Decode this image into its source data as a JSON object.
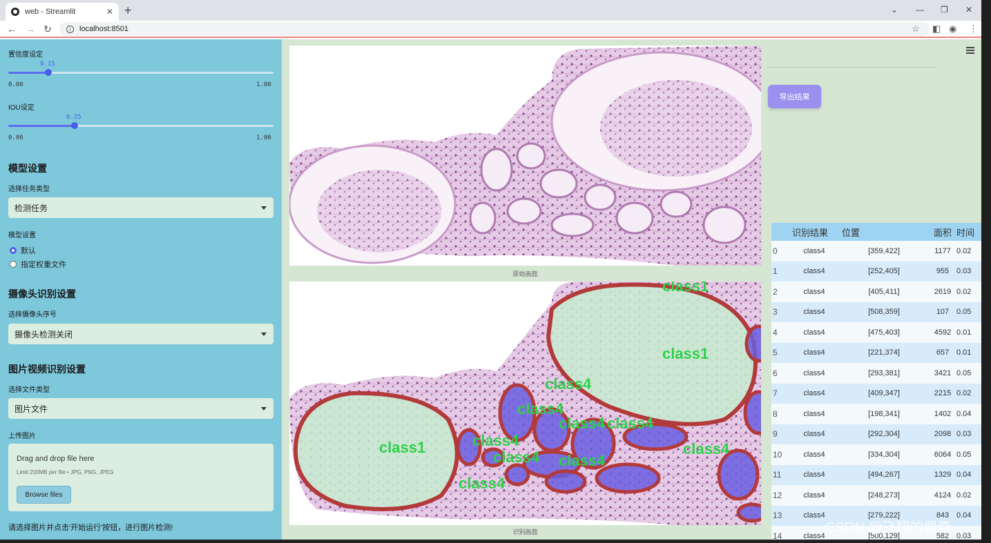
{
  "browser": {
    "tab_title": "web - Streamlit",
    "url": "localhost:8501"
  },
  "sidebar": {
    "confidence": {
      "label": "置信度设定",
      "value": "0.15",
      "value_fraction": 0.15,
      "min": "0.00",
      "max": "1.00"
    },
    "iou": {
      "label": "IOU设定",
      "value": "0.25",
      "value_fraction": 0.25,
      "min": "0.00",
      "max": "1.00"
    },
    "model_section": "模型设置",
    "task_label": "选择任务类型",
    "task_value": "检测任务",
    "model_label": "模型设置",
    "radio_default": "默认",
    "radio_custom": "指定权重文件",
    "camera_section": "摄像头识别设置",
    "camera_label": "选择摄像头序号",
    "camera_value": "摄像头检测关闭",
    "media_section": "图片视频识别设置",
    "file_type_label": "选择文件类型",
    "file_type_value": "图片文件",
    "upload_label": "上传图片",
    "upload_drag": "Drag and drop file here",
    "upload_limit": "Limit 200MB per file • JPG, PNG, JPEG",
    "browse_button": "Browse files",
    "footer_hint": "请选择图片并点击'开始运行'按钮，进行图片检测!"
  },
  "main": {
    "original_caption": "原始画面",
    "result_caption": "识别画面",
    "export_button": "导出结果",
    "overlay_labels": [
      "class1",
      "class1",
      "class1",
      "class4",
      "class4",
      "class4",
      "class4",
      "class4",
      "class4",
      "class4",
      "class4",
      "class4"
    ],
    "table": {
      "headers": [
        "",
        "识别结果",
        "位置",
        "面积",
        "时间"
      ],
      "rows": [
        [
          "0",
          "class4",
          "[359,422]",
          "1177",
          "0.02"
        ],
        [
          "1",
          "class4",
          "[252,405]",
          "955",
          "0.03"
        ],
        [
          "2",
          "class4",
          "[405,411]",
          "2619",
          "0.02"
        ],
        [
          "3",
          "class4",
          "[508,359]",
          "107",
          "0.05"
        ],
        [
          "4",
          "class4",
          "[475,403]",
          "4592",
          "0.01"
        ],
        [
          "5",
          "class4",
          "[221,374]",
          "657",
          "0.01"
        ],
        [
          "6",
          "class4",
          "[293,381]",
          "3421",
          "0.05"
        ],
        [
          "7",
          "class4",
          "[409,347]",
          "2215",
          "0.02"
        ],
        [
          "8",
          "class4",
          "[198,341]",
          "1402",
          "0.04"
        ],
        [
          "9",
          "class4",
          "[292,304]",
          "2098",
          "0.03"
        ],
        [
          "10",
          "class4",
          "[334,304]",
          "6064",
          "0.05"
        ],
        [
          "11",
          "class4",
          "[494,267]",
          "1329",
          "0.04"
        ],
        [
          "12",
          "class4",
          "[248,273]",
          "4124",
          "0.02"
        ],
        [
          "13",
          "class4",
          "[279,222]",
          "843",
          "0.04"
        ],
        [
          "14",
          "class4",
          "[500,129]",
          "582",
          "0.03"
        ]
      ]
    }
  },
  "watermark": "CSDN @飞翔的佩奇",
  "colors": {
    "sidebar": "#7ec8dc",
    "main": "#d5e6d3",
    "accent": "#4a5de8",
    "export": "#9b8ff0",
    "seg_outline": "#b33a3a",
    "seg_class1": "#c5ecd0",
    "seg_class4": "#6a5fe0"
  }
}
